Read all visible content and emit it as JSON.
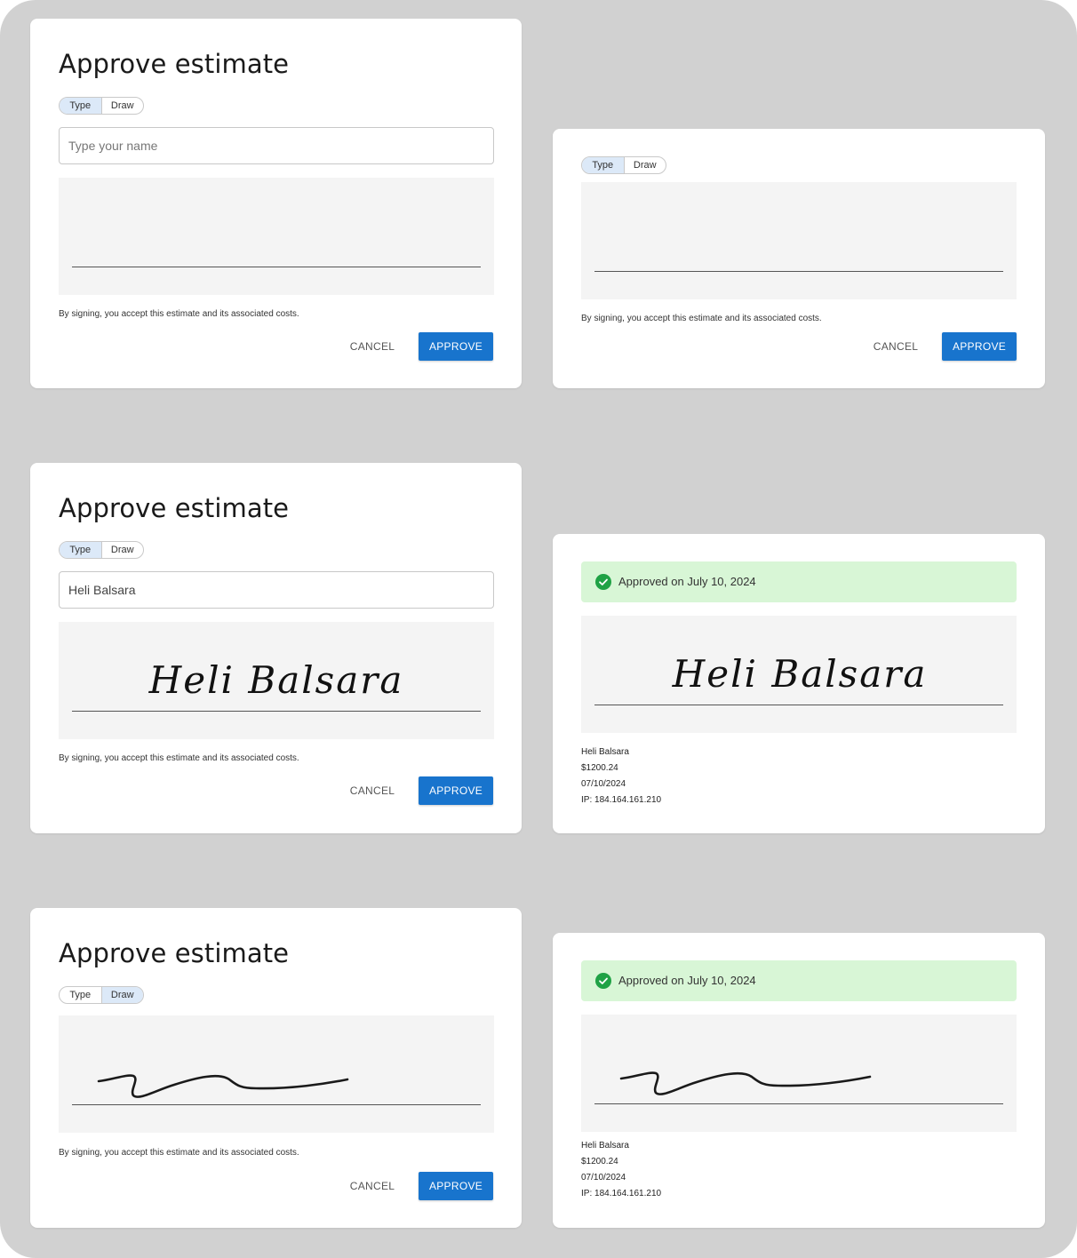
{
  "dialog": {
    "title": "Approve estimate",
    "type_label": "Type",
    "draw_label": "Draw",
    "name_placeholder": "Type your name",
    "disclaimer": "By signing, you accept this estimate and its associated costs.",
    "cancel_label": "CANCEL",
    "approve_label": "APPROVE"
  },
  "typed_state": {
    "name_value": "Heli Balsara",
    "signature_text": "Heli Balsara"
  },
  "approved": {
    "banner_text": "Approved on July 10, 2024",
    "signer_name": "Heli Balsara",
    "amount": "$1200.24",
    "date": "07/10/2024",
    "ip": "IP: 184.164.161.210"
  },
  "colors": {
    "primary": "#1874cd",
    "success": "#1fa245",
    "success_bg": "#d8f6d6",
    "toggle_active": "#dce9f8",
    "signature_pad": "#f4f4f4",
    "background": "#d1d1d1"
  },
  "icons": {
    "approved_check": "check-circle-icon"
  }
}
